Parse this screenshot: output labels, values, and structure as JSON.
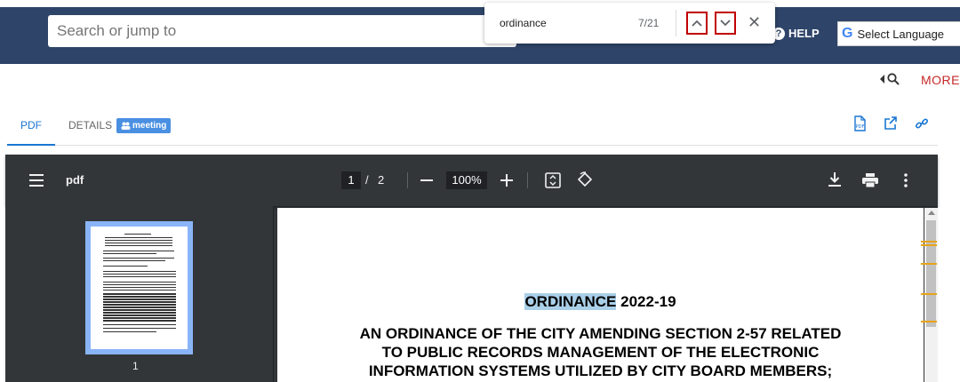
{
  "header": {
    "search_placeholder": "Search or jump to",
    "help_label": "HELP",
    "language_label": "Select Language"
  },
  "findbar": {
    "query": "ordinance",
    "count": "7/21"
  },
  "secondary": {
    "more_label": "MORE"
  },
  "tabs": {
    "pdf_label": "PDF",
    "details_label": "DETAILS",
    "badge_label": "meeting"
  },
  "viewer": {
    "title": "pdf",
    "current_page": "1",
    "total_pages": "2",
    "zoom": "100%",
    "thumb_page_number": "1"
  },
  "document": {
    "highlight_term": "ORDINANCE",
    "title_rest": " 2022-19",
    "lines": [
      "AN ORDINANCE OF THE CITY AMENDING SECTION 2-57 RELATED",
      "TO PUBLIC RECORDS MANAGEMENT OF THE ELECTRONIC",
      "INFORMATION SYSTEMS UTILIZED BY CITY BOARD MEMBERS;"
    ]
  },
  "colors": {
    "navy": "#2e4468",
    "accent_blue": "#1976d2",
    "more_red": "#c62828",
    "find_button_border": "#c00000",
    "highlight": "#aacfe8"
  }
}
